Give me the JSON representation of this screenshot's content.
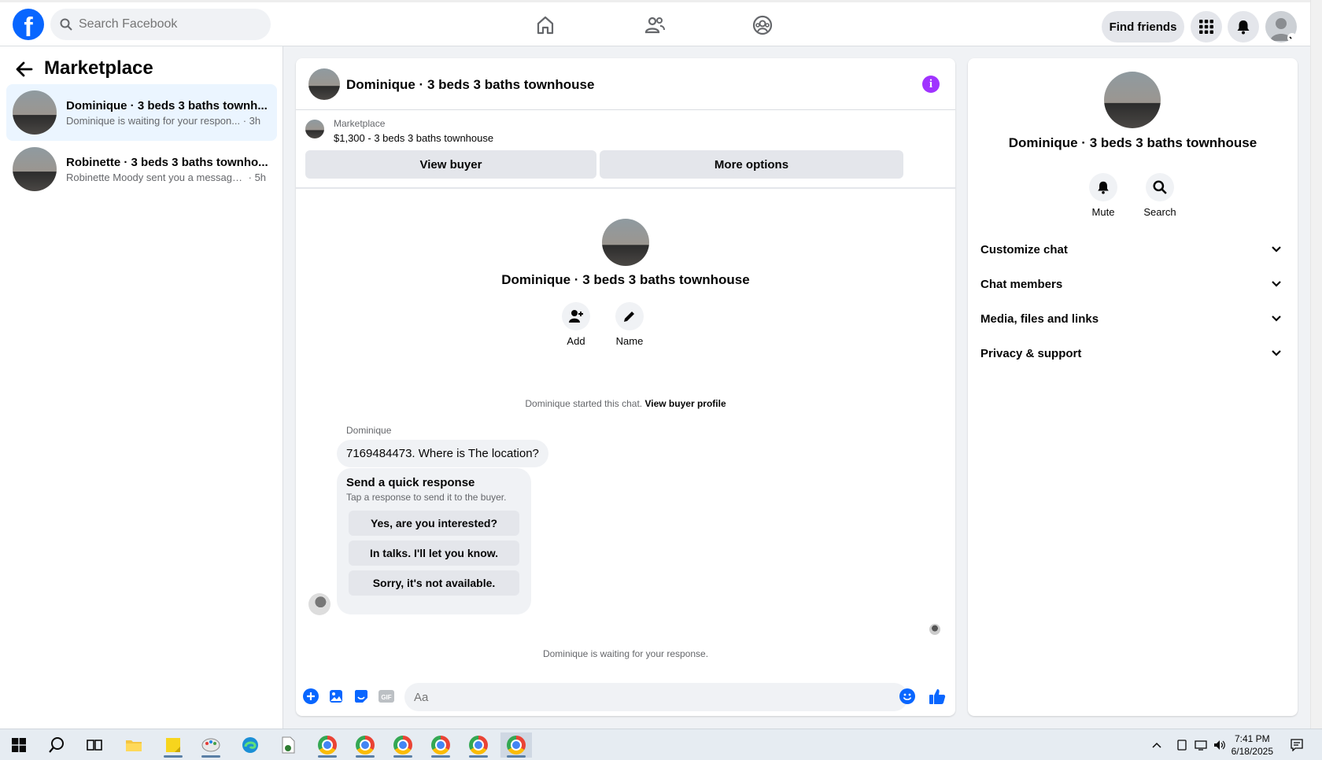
{
  "topbar": {
    "search_placeholder": "Search Facebook",
    "find_friends_label": "Find friends",
    "nav_icons": [
      "home-icon",
      "friends-icon",
      "groups-icon"
    ],
    "right_icons": [
      "menu-grid-icon",
      "notifications-bell-icon",
      "profile-avatar"
    ]
  },
  "sidebar": {
    "title": "Marketplace",
    "conversations": [
      {
        "title": "Dominique · 3 beds 3 baths townh...",
        "snippet": "Dominique is waiting for your respon...",
        "time": "· 3h",
        "active": true
      },
      {
        "title": "Robinette · 3 beds 3 baths townho...",
        "snippet": "Robinette Moody sent you a message...",
        "time": "· 5h",
        "active": false
      }
    ]
  },
  "chat": {
    "header_title": "Dominique · 3 beds 3 baths townhouse",
    "listing_category": "Marketplace",
    "listing_desc": "$1,300 - 3 beds 3 baths townhouse",
    "view_buyer_label": "View buyer",
    "more_options_label": "More options",
    "center_title": "Dominique · 3 beds 3 baths townhouse",
    "add_label": "Add",
    "name_label": "Name",
    "started_text": "Dominique started this chat.",
    "view_buyer_profile": "View buyer profile",
    "sender_name": "Dominique",
    "message": "7169484473. Where is The location?",
    "quick_title": "Send a quick response",
    "quick_sub": "Tap a response to send it to the buyer.",
    "quick_responses": [
      "Yes, are you interested?",
      "In talks. I'll let you know.",
      "Sorry, it's not available."
    ],
    "waiting_text": "Dominique is waiting for your response.",
    "composer_placeholder": "Aa",
    "gif_label": "GIF"
  },
  "details": {
    "title": "Dominique · 3 beds 3 baths townhouse",
    "mute_label": "Mute",
    "search_label": "Search",
    "sections": [
      "Customize chat",
      "Chat members",
      "Media, files and links",
      "Privacy & support"
    ]
  },
  "taskbar": {
    "time": "7:41 PM",
    "date": "6/18/2025"
  },
  "colors": {
    "accent": "#0866ff",
    "info": "#a033ff",
    "active_conversation": "#ebf5ff"
  }
}
